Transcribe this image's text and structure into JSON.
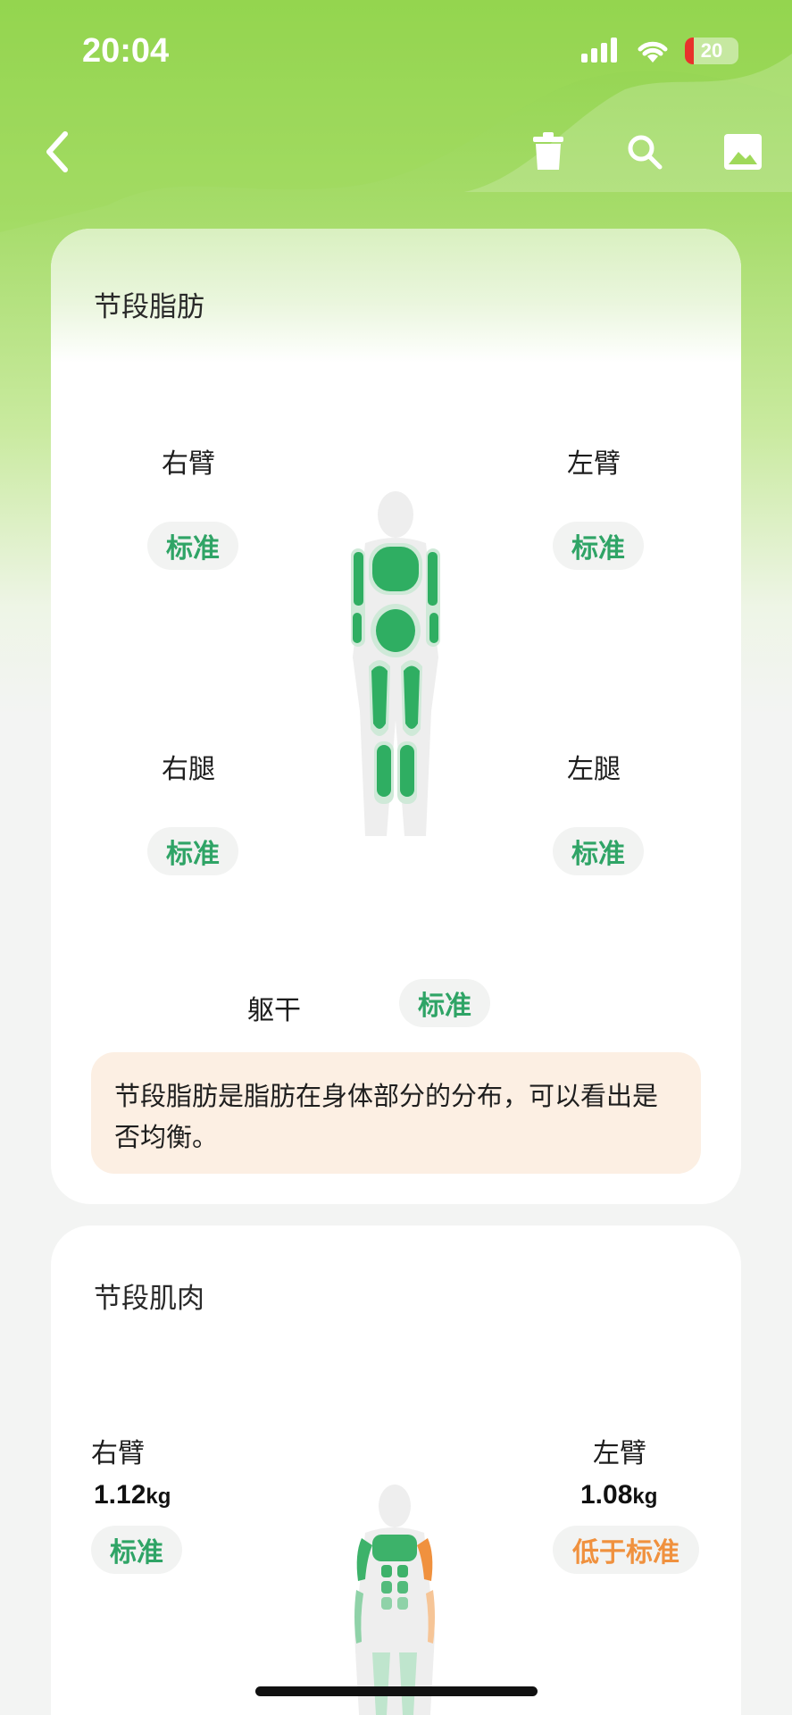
{
  "status": {
    "time": "20:04",
    "battery": "20"
  },
  "nav": {
    "back": "back-icon",
    "delete": "trash-icon",
    "search": "search-icon",
    "image": "image-icon"
  },
  "fat_card": {
    "title": "节段脂肪",
    "right_arm": {
      "label": "右臂",
      "status": "标准"
    },
    "left_arm": {
      "label": "左臂",
      "status": "标准"
    },
    "right_leg": {
      "label": "右腿",
      "status": "标准"
    },
    "left_leg": {
      "label": "左腿",
      "status": "标准"
    },
    "trunk": {
      "label": "躯干",
      "status": "标准"
    },
    "note": "节段脂肪是脂肪在身体部分的分布，可以看出是否均衡。"
  },
  "muscle_card": {
    "title": "节段肌肉",
    "right_arm": {
      "label": "右臂",
      "value": "1.12",
      "unit": "kg",
      "status": "标准"
    },
    "left_arm": {
      "label": "左臂",
      "value": "1.08",
      "unit": "kg",
      "status": "低于标准"
    }
  },
  "colors": {
    "accent": "#2fa466",
    "warning": "#f0913e",
    "header": "#8fd34a"
  }
}
